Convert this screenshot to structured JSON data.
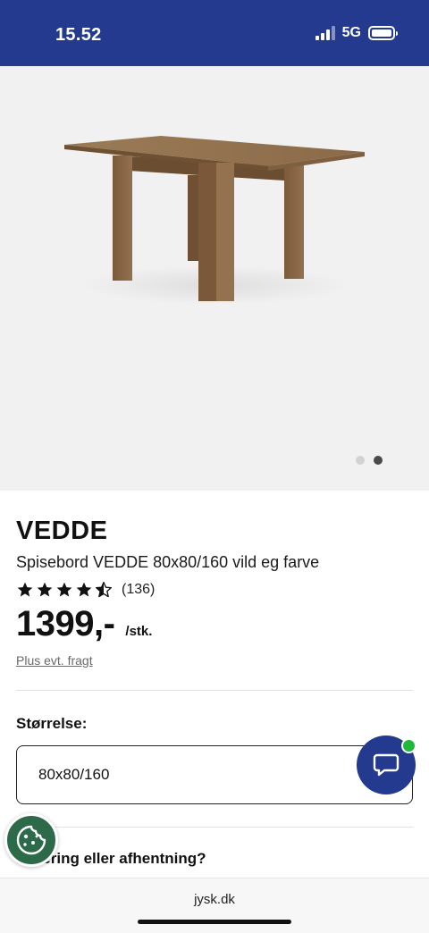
{
  "status_bar": {
    "time": "15.52",
    "network": "5G",
    "signal_bars": 3,
    "battery": "full"
  },
  "gallery": {
    "image_count": 2,
    "active_index": 1,
    "image_alt": "dining-table"
  },
  "product": {
    "brand": "VEDDE",
    "title": "Spisebord VEDDE 80x80/160 vild eg farve",
    "rating": 4.5,
    "reviews": "(136)",
    "price": "1399,-",
    "unit": "/stk.",
    "freight_link": "Plus evt. fragt"
  },
  "size": {
    "label": "Størrelse:",
    "value": "80x80/160"
  },
  "delivery": {
    "heading": "Levering eller afhentning?"
  },
  "browser": {
    "url": "jysk.dk"
  },
  "icons": {
    "chat": "chat-bubble-icon",
    "cookie": "cookie-icon"
  },
  "colors": {
    "brand_blue": "#233a8e",
    "online_green": "#1fb83a",
    "cookie_green": "#2d6a4a"
  }
}
